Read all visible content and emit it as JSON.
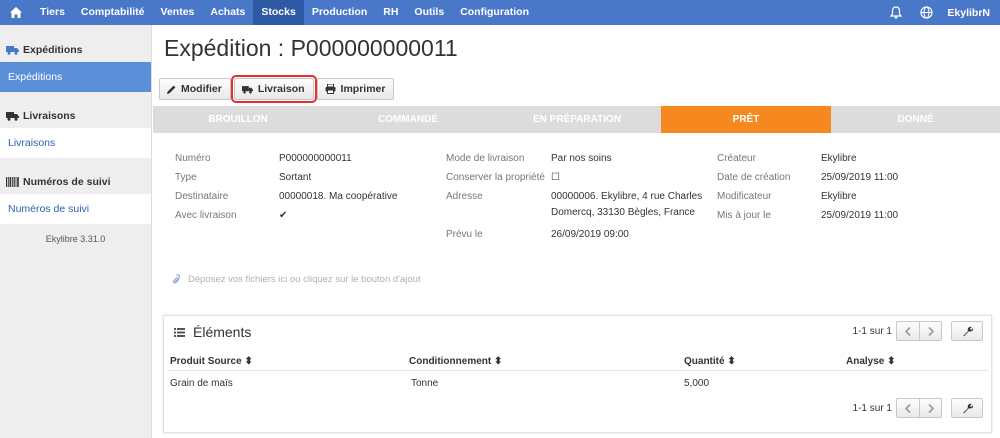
{
  "nav": {
    "items": [
      "Tiers",
      "Comptabilité",
      "Ventes",
      "Achats",
      "Stocks",
      "Production",
      "RH",
      "Outils",
      "Configuration"
    ],
    "active": "Stocks",
    "user": "EkylibrN"
  },
  "sidebar": {
    "sections": [
      {
        "heading": "Expéditions",
        "link": "Expéditions"
      },
      {
        "heading": "Livraisons",
        "link": "Livraisons"
      },
      {
        "heading": "Numéros de suivi",
        "link": "Numéros de suivi"
      }
    ],
    "version": "Ekylibre 3.31.0"
  },
  "page": {
    "title": "Expédition : P000000000011"
  },
  "toolbar": {
    "modifier": "Modifier",
    "livraison": "Livraison",
    "imprimer": "Imprimer"
  },
  "steps": [
    "BROUILLON",
    "COMMANDÉ",
    "EN PRÉPARATION",
    "PRÊT",
    "DONNÉ"
  ],
  "info": {
    "col1": [
      {
        "label": "Numéro",
        "value": "P000000000011"
      },
      {
        "label": "Type",
        "value": "Sortant"
      },
      {
        "label": "Destinataire",
        "value": "00000018. Ma coopérative"
      },
      {
        "label": "Avec livraison",
        "value": "✔"
      }
    ],
    "col2": [
      {
        "label": "Mode de livraison",
        "value": "Par nos soins"
      },
      {
        "label": "Conserver la propriété",
        "value": "☐"
      },
      {
        "label": "Adresse",
        "value": "00000006. Ekylibre, 4 rue Charles",
        "value2": "Domercq, 33130 Bègles, France"
      },
      {
        "label": "Prévu le",
        "value": "26/09/2019 09:00"
      }
    ],
    "col3": [
      {
        "label": "Créateur",
        "value": "Ekylibre"
      },
      {
        "label": "Date de création",
        "value": "25/09/2019 11:00"
      },
      {
        "label": "Modificateur",
        "value": "Ekylibre"
      },
      {
        "label": "Mis à jour le",
        "value": "25/09/2019 11:00"
      }
    ]
  },
  "dropzone": "Déposez vos fichiers ici ou cliquez sur le bouton d'ajout",
  "elements": {
    "title": "Éléments",
    "pagination": "1-1 sur 1",
    "columns": [
      "Produit Source",
      "Conditionnement",
      "Quantité",
      "Analyse"
    ],
    "rows": [
      {
        "produit": "Grain de maïs",
        "conditionnement": "Tonne",
        "quantite": "5,000",
        "analyse": ""
      }
    ]
  }
}
